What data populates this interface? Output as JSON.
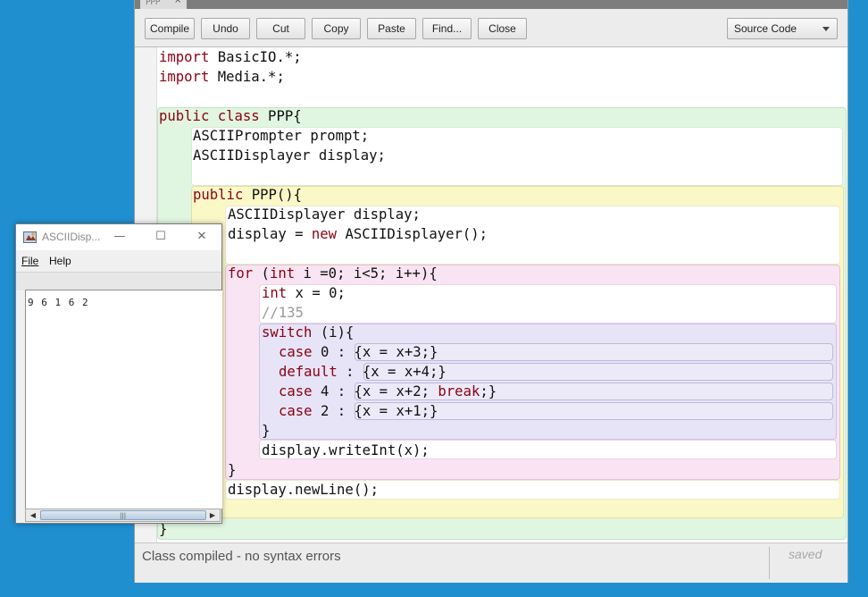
{
  "editor": {
    "tab_label": "PPP",
    "toolbar": {
      "compile": "Compile",
      "undo": "Undo",
      "cut": "Cut",
      "copy": "Copy",
      "paste": "Paste",
      "find": "Find...",
      "close": "Close",
      "view_selector": "Source Code"
    },
    "code": {
      "l1_kw": "import",
      "l1_rest": " BasicIO.*;",
      "l2_kw": "import",
      "l2_rest": " Media.*;",
      "l4_kw": "public class",
      "l4_rest": " PPP{",
      "l5": "ASCIIPrompter prompt;",
      "l6": "ASCIIDisplayer display;",
      "l8_kw": "public",
      "l8_rest": " PPP(){",
      "l9": "ASCIIDisplayer display;",
      "l10_a": "display = ",
      "l10_kw": "new",
      "l10_b": " ASCIIDisplayer();",
      "l12_kw1": "for",
      "l12_a": " (",
      "l12_kw2": "int",
      "l12_b": " i =0; i<5; i++){",
      "l13_kw": "int",
      "l13_rest": " x = 0;",
      "l14": "//135",
      "l15_kw": "switch",
      "l15_rest": " (i){",
      "l16_kw": "case",
      "l16_a": " 0 : ",
      "l16_b": "{x = x+3;}",
      "l17_kw": "default",
      "l17_a": " : ",
      "l17_b": "{x = x+4;}",
      "l18_kw": "case",
      "l18_a": " 4 : ",
      "l18_b": "{x = x+2; ",
      "l18_kw2": "break",
      "l18_c": ";}",
      "l19_kw": "case",
      "l19_a": " 2 : ",
      "l19_b": "{x = x+1;}",
      "l20": "}",
      "l21": "display.writeInt(x);",
      "l22": "}",
      "l23": "display.newLine();",
      "l25": "}"
    },
    "status": "Class compiled - no syntax errors",
    "saved": "saved"
  },
  "ascii_window": {
    "title": "ASCIIDisp...",
    "menu_file": "File",
    "menu_help": "Help",
    "output": "9 6 1 6 2"
  }
}
